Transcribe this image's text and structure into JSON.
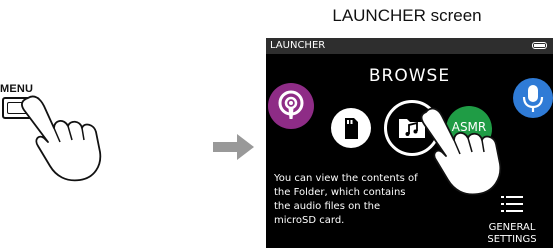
{
  "menu_button": {
    "label": "MENU"
  },
  "caption": "LAUNCHER screen",
  "device": {
    "status_title": "LAUNCHER",
    "browse_title": "BROWSE",
    "asmr_label": "ASMR",
    "description": [
      "You can view the contents of",
      "the Folder, which contains",
      "the audio files on the",
      "microSD card."
    ],
    "general_settings": [
      "GENERAL",
      "SETTINGS"
    ]
  },
  "colors": {
    "podcast": "#8e2c86",
    "asmr": "#1f9c45",
    "mic": "#2f7bd6",
    "arrow": "#999999"
  }
}
